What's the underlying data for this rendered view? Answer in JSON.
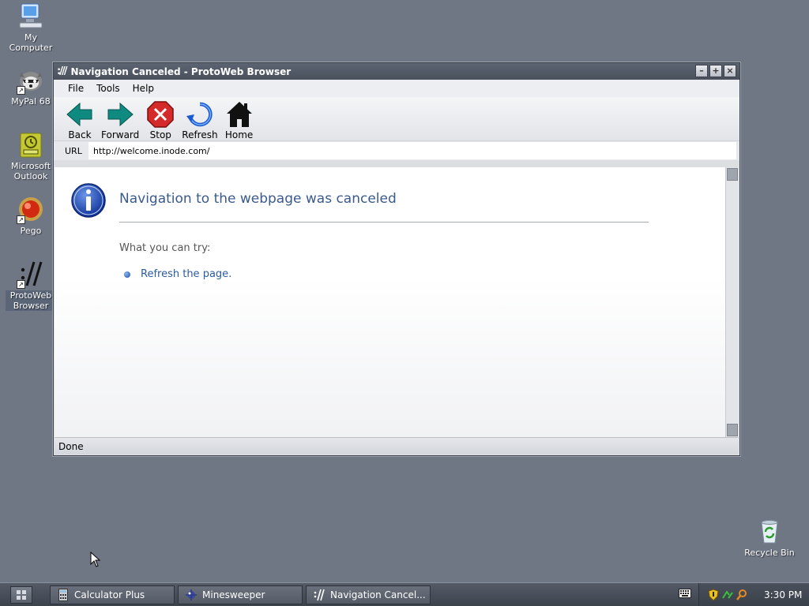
{
  "desktop": {
    "icons": [
      {
        "label": "My Computer"
      },
      {
        "label": "MyPal 68"
      },
      {
        "label": "Microsoft Outlook"
      },
      {
        "label": "Pego"
      },
      {
        "label": "ProtoWeb Browser"
      },
      {
        "label": "Recycle Bin"
      }
    ]
  },
  "window": {
    "title": "Navigation Canceled - ProtoWeb Browser",
    "app_glyph": ":///",
    "minimize": "–",
    "maximize": "+",
    "close": "×",
    "menu": [
      "File",
      "Tools",
      "Help"
    ],
    "toolbar": {
      "back": "Back",
      "forward": "Forward",
      "stop": "Stop",
      "refresh": "Refresh",
      "home": "Home"
    },
    "url_label": "URL",
    "url_value": "http://welcome.inode.com/",
    "status": "Done"
  },
  "page": {
    "heading": "Navigation to the webpage was canceled",
    "try_text": "What you can try:",
    "suggestion": "Refresh the page."
  },
  "taskbar": {
    "tasks": [
      {
        "label": "Calculator Plus",
        "icon": "calculator-icon"
      },
      {
        "label": "Minesweeper",
        "icon": "minesweeper-icon"
      },
      {
        "label": "Navigation Cancel...",
        "icon": "protoweb-icon"
      }
    ],
    "clock": "3:30 PM"
  },
  "colors": {
    "desktop": "#6f7684",
    "heading": "#3a5a8c",
    "link": "#2a5aa0",
    "toolbar_arrow": "#0e8a80",
    "stop": "#d42a2a"
  }
}
